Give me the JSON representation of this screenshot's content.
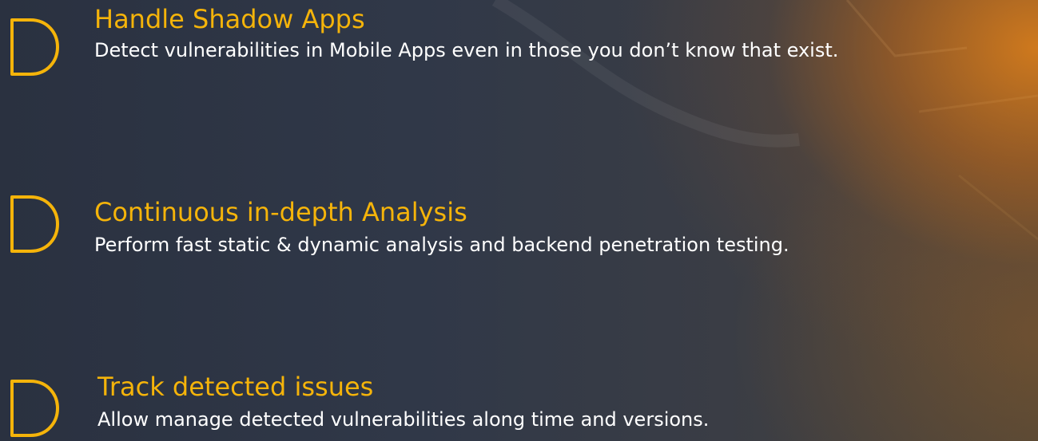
{
  "features": [
    {
      "title": "Handle Shadow Apps",
      "description": "Detect vulnerabilities in Mobile Apps even in those you don’t know that exist."
    },
    {
      "title": "Continuous in-depth Analysis",
      "description": "Perform fast static & dynamic analysis and backend penetration testing."
    },
    {
      "title": "Track detected issues",
      "description": "Allow manage detected vulnerabilities along time and versions."
    }
  ],
  "colors": {
    "accent": "#f5b40a",
    "text": "#ffffff",
    "background": "#2b3342"
  },
  "icons": [
    "bracket-icon"
  ]
}
